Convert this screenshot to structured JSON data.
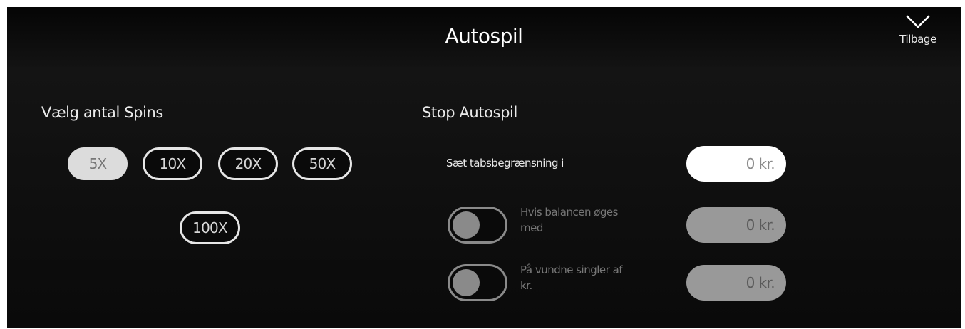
{
  "header": {
    "title": "Autospil",
    "back_label": "Tilbage",
    "back_icon": "chevron-down-icon"
  },
  "spins": {
    "title": "Vælg antal Spins",
    "options": [
      "5X",
      "10X",
      "20X",
      "50X",
      "100X"
    ],
    "selected": "5X"
  },
  "stop": {
    "title": "Stop Autospil",
    "loss_limit": {
      "label": "Sæt tabsbegrænsning i",
      "value": "0 kr."
    },
    "balance_increase": {
      "label_line1": "Hvis balancen øges",
      "label_line2": "med",
      "value": "0 kr.",
      "enabled": false
    },
    "single_win": {
      "label_line1": "På vundne singler af",
      "label_line2": "kr.",
      "value": "0 kr.",
      "enabled": false
    }
  },
  "colors": {
    "background": "#0d0d0d",
    "selected_button": "#dcdcdc",
    "border": "#e6e6e6",
    "disabled_field": "#999999",
    "toggle_off": "#8a8a8a"
  }
}
